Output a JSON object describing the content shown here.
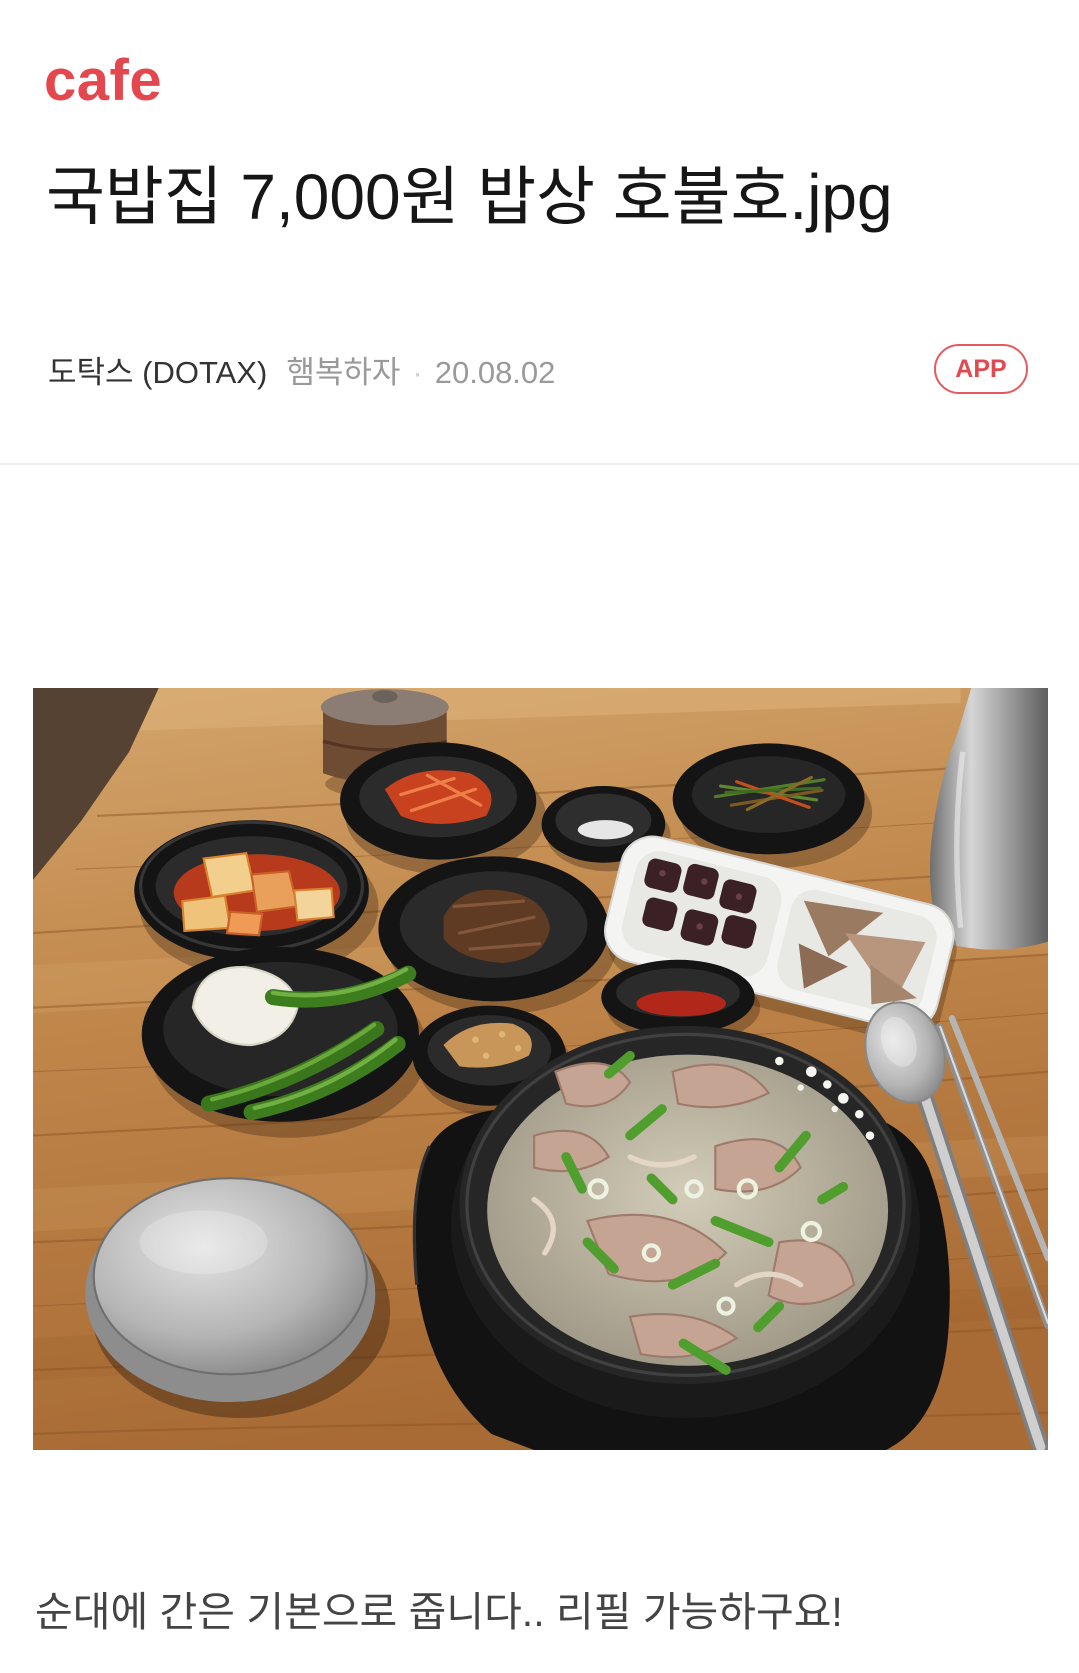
{
  "header": {
    "logo": "cafe"
  },
  "post": {
    "title": "국밥집 7,000원 밥상 호불호.jpg",
    "cafe_name": "도탁스 (DOTAX)",
    "author": "햄복하자",
    "separator": "·",
    "date": "20.08.02",
    "app_button_label": "APP",
    "caption": "순대에 간은 기본으로 줍니다.. 리필 가능하구요!"
  },
  "colors": {
    "brand": "#e5474e",
    "title_text": "#161616",
    "muted_text": "#9a9a9a",
    "divider": "#eeeeee"
  }
}
